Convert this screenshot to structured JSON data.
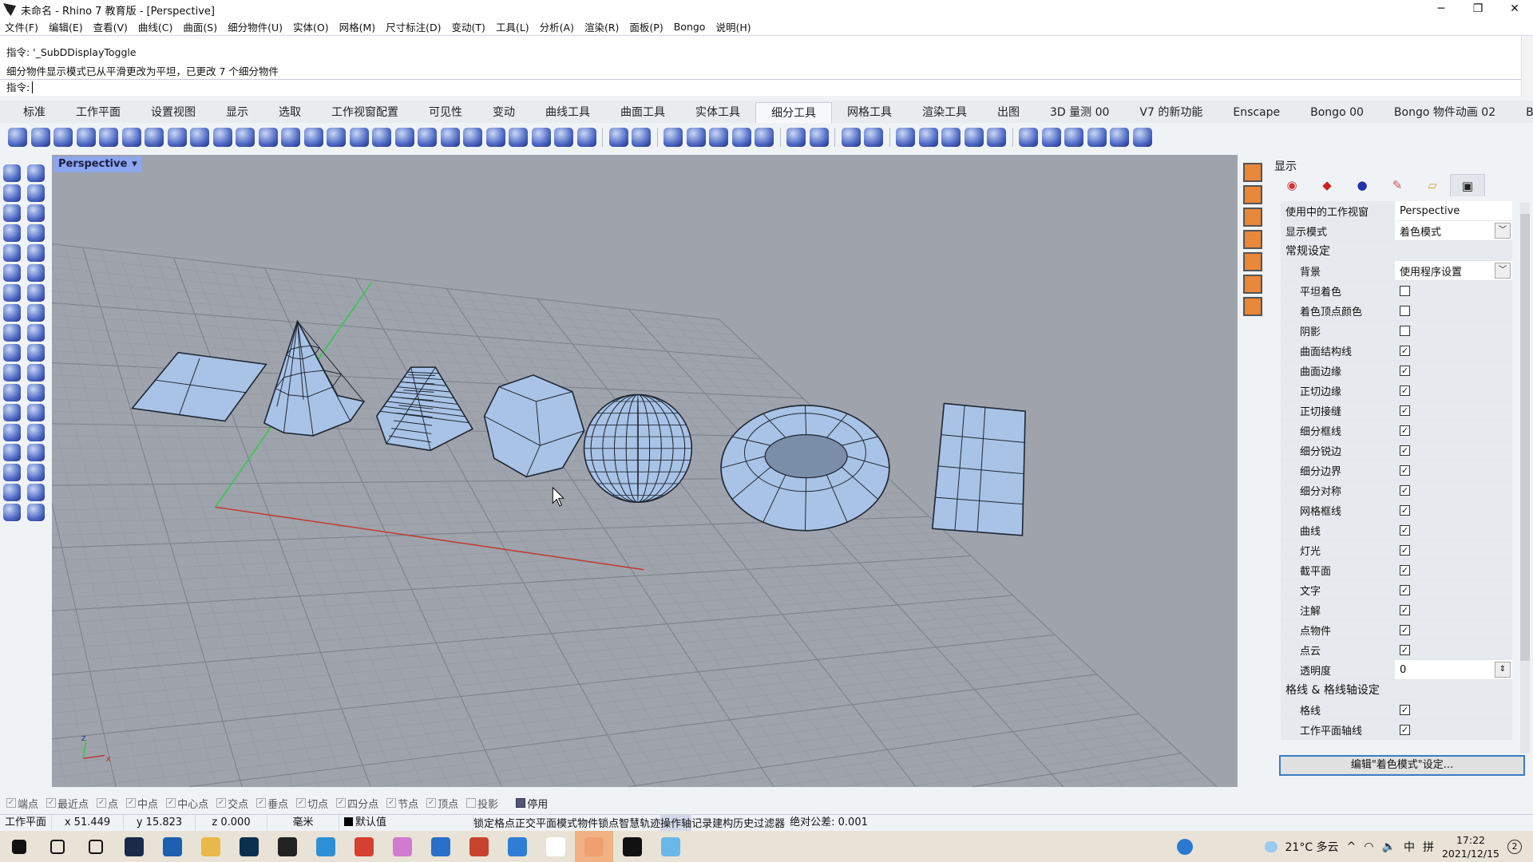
{
  "window": {
    "title": "未命名 - Rhino 7 教育版 - [Perspective]",
    "minimize": "─",
    "restore": "❐",
    "close": "✕"
  },
  "menu": [
    "文件(F)",
    "编辑(E)",
    "查看(V)",
    "曲线(C)",
    "曲面(S)",
    "细分物件(U)",
    "实体(O)",
    "网格(M)",
    "尺寸标注(D)",
    "变动(T)",
    "工具(L)",
    "分析(A)",
    "渲染(R)",
    "面板(P)",
    "Bongo",
    "说明(H)"
  ],
  "command": {
    "history": [
      "指令: '_SubDDisplayToggle",
      "细分物件显示模式已从平滑更改为平坦，已更改 7 个细分物件"
    ],
    "prompt": "指令:",
    "value": ""
  },
  "tabs": [
    {
      "label": "标准"
    },
    {
      "label": "工作平面"
    },
    {
      "label": "设置视图"
    },
    {
      "label": "显示"
    },
    {
      "label": "选取"
    },
    {
      "label": "工作视窗配置"
    },
    {
      "label": "可见性"
    },
    {
      "label": "变动"
    },
    {
      "label": "曲线工具"
    },
    {
      "label": "曲面工具"
    },
    {
      "label": "实体工具"
    },
    {
      "label": "细分工具",
      "active": true
    },
    {
      "label": "网格工具"
    },
    {
      "label": "渲染工具"
    },
    {
      "label": "出图"
    },
    {
      "label": "3D 量测 00"
    },
    {
      "label": "V7 的新功能"
    },
    {
      "label": "Enscape"
    },
    {
      "label": "Bongo 00"
    },
    {
      "label": "Bongo 物件动画 02"
    },
    {
      "label": "Bongo P"
    },
    {
      "label": "»"
    }
  ],
  "toolbar_icons": [
    "subd-box-icon",
    "subd-plane-icon",
    "subd-cone-icon",
    "subd-tcone-icon",
    "subd-cylinder-icon",
    "subd-sphere-icon",
    "subd-ellipsoid-icon",
    "subd-torus-icon",
    "subd-quadsphere-icon",
    "subd-loft-icon",
    "subd-loft2-icon",
    "subd-sweep-icon",
    "subd-pipe-icon",
    "subd-patch-icon",
    "subd-rail-icon",
    "subd-edit-icon",
    "subd-bridge-icon",
    "subd-extrude-icon",
    "subd-extrude-face-icon",
    "subd-offset-icon",
    "subd-fill-icon",
    "subd-weld-icon",
    "subd-insert-edge-icon",
    "subd-subdivide-icon",
    "subd-stitch-icon",
    "subd-cup-icon",
    "sep",
    "subd-slide-icon",
    "subd-crease-icon",
    "sep",
    "subd-mirror-icon",
    "subd-bevel-icon",
    "subd-face-icon",
    "subd-select-icon",
    "subd-merge-icon",
    "sep",
    "subd-mesh-icon",
    "subd-list-icon",
    "sep",
    "wrench-icon",
    "convert-icon",
    "sep",
    "subd-box-select-icon",
    "subd-ruled-icon",
    "subd-globe-icon",
    "subd-flag-icon",
    "brush-icon",
    "sep",
    "select-vertices-icon",
    "select-faces-icon",
    "select-edges-icon",
    "filter-off-icon",
    "filter-cycle-icon",
    "heart-select-icon"
  ],
  "left_icons": [
    "select-arrow-icon",
    "point-icon",
    "polyline-icon",
    "control-point-curve-icon",
    "circle-icon",
    "ellipse-icon",
    "polygon-icon",
    "rectangle-icon",
    "arc-icon",
    "curve-fillet-icon",
    "surface-corner-icon",
    "surface-edge-icon",
    "extrude-icon",
    "boolean-union-icon",
    "pipe-icon",
    "plane-icon",
    "sweep-icon",
    "surface-network-icon",
    "trim-icon",
    "split-icon",
    "solid-sphere-icon",
    "solid-explode-icon",
    "fillet-icon",
    "offset-icon",
    "text-icon",
    "dimension-icon",
    "move-icon",
    "align-icon",
    "block-icon",
    "measure-icon",
    "array-icon",
    "history-icon",
    "render-icon",
    "check-icon",
    "shade-icon",
    "lighting-icon"
  ],
  "viewport": {
    "name": "Perspective",
    "menu_arrow": "▾",
    "axis_x": "x",
    "axis_y": "y",
    "axis_z": "z",
    "colors": {
      "background": "#9ea3ac",
      "x_axis": "#c0392b",
      "y_axis": "#2ecc40",
      "surface": "#a9c3e6",
      "edge": "#1d2633"
    }
  },
  "panel": {
    "title": "显示",
    "tabs": [
      "color-wheel-icon",
      "material-icon",
      "bomb-icon",
      "paint-icon",
      "folder-icon",
      "display-monitor-icon"
    ],
    "rows": [
      {
        "label": "使用中的工作视窗",
        "value": "Perspective",
        "kind": "text"
      },
      {
        "label": "显示模式",
        "value": "着色模式",
        "kind": "dropdown"
      },
      {
        "label": "常规设定",
        "kind": "section"
      },
      {
        "label": "背景",
        "value": "使用程序设置",
        "kind": "dropdown",
        "sub": true
      },
      {
        "label": "平坦着色",
        "checked": false,
        "kind": "check",
        "sub": true
      },
      {
        "label": "着色顶点颜色",
        "checked": false,
        "kind": "check",
        "sub": true
      },
      {
        "label": "阴影",
        "checked": false,
        "kind": "check",
        "sub": true
      },
      {
        "label": "曲面结构线",
        "checked": true,
        "kind": "check",
        "sub": true
      },
      {
        "label": "曲面边缘",
        "checked": true,
        "kind": "check",
        "sub": true
      },
      {
        "label": "正切边缘",
        "checked": true,
        "kind": "check",
        "sub": true
      },
      {
        "label": "正切接缝",
        "checked": true,
        "kind": "check",
        "sub": true
      },
      {
        "label": "细分框线",
        "checked": true,
        "kind": "check",
        "sub": true
      },
      {
        "label": "细分锐边",
        "checked": true,
        "kind": "check",
        "sub": true
      },
      {
        "label": "细分边界",
        "checked": true,
        "kind": "check",
        "sub": true
      },
      {
        "label": "细分对称",
        "checked": true,
        "kind": "check",
        "sub": true
      },
      {
        "label": "网格框线",
        "checked": true,
        "kind": "check",
        "sub": true
      },
      {
        "label": "曲线",
        "checked": true,
        "kind": "check",
        "sub": true
      },
      {
        "label": "灯光",
        "checked": true,
        "kind": "check",
        "sub": true
      },
      {
        "label": "截平面",
        "checked": true,
        "kind": "check",
        "sub": true
      },
      {
        "label": "文字",
        "checked": true,
        "kind": "check",
        "sub": true
      },
      {
        "label": "注解",
        "checked": true,
        "kind": "check",
        "sub": true
      },
      {
        "label": "点物件",
        "checked": true,
        "kind": "check",
        "sub": true
      },
      {
        "label": "点云",
        "checked": true,
        "kind": "check",
        "sub": true
      },
      {
        "label": "透明度",
        "value": "0",
        "kind": "spinner",
        "sub": true
      },
      {
        "label": "格线 & 格线轴设定",
        "kind": "section"
      },
      {
        "label": "格线",
        "checked": true,
        "kind": "check",
        "sub": true
      },
      {
        "label": "工作平面轴线",
        "checked": true,
        "kind": "check",
        "sub": true
      }
    ],
    "edit_button": "编辑\"着色模式\"设定..."
  },
  "osnap": [
    {
      "label": "端点",
      "checked": true
    },
    {
      "label": "最近点",
      "checked": true
    },
    {
      "label": "点",
      "checked": true
    },
    {
      "label": "中点",
      "checked": true
    },
    {
      "label": "中心点",
      "checked": true
    },
    {
      "label": "交点",
      "checked": true
    },
    {
      "label": "垂点",
      "checked": true
    },
    {
      "label": "切点",
      "checked": true
    },
    {
      "label": "四分点",
      "checked": true
    },
    {
      "label": "节点",
      "checked": true
    },
    {
      "label": "顶点",
      "checked": true
    },
    {
      "label": "投影",
      "checked": false
    },
    {
      "label": "停用",
      "checked": false
    }
  ],
  "status": {
    "cplane": "工作平面",
    "x": "x 51.449",
    "y": "y 15.823",
    "z": "z 0.000",
    "unit": "毫米",
    "layer": "默认值",
    "toggles": [
      "锁定格点",
      "正交",
      "平面模式",
      "物件锁点",
      "智慧轨迹",
      "操作轴",
      "记录建构历史",
      "过滤器"
    ],
    "tolerance": "绝对公差: 0.001"
  },
  "taskbar": {
    "apps": [
      "windows-start-icon",
      "search-icon",
      "task-view-icon",
      "app-icon",
      "store-icon",
      "file-explorer-icon",
      "photoshop-icon",
      "qq-icon",
      "browser-icon",
      "chrome-icon",
      "color-app-icon",
      "sketch-app-icon",
      "powerpoint-icon",
      "edge-icon",
      "dots-app-icon",
      "wechat-icon",
      "rhino-icon",
      "image-app-icon"
    ],
    "weather": "21°C 多云",
    "ime1": "中",
    "ime2": "拼",
    "time": "17:22",
    "date": "2021/12/15",
    "notifications": "2"
  }
}
